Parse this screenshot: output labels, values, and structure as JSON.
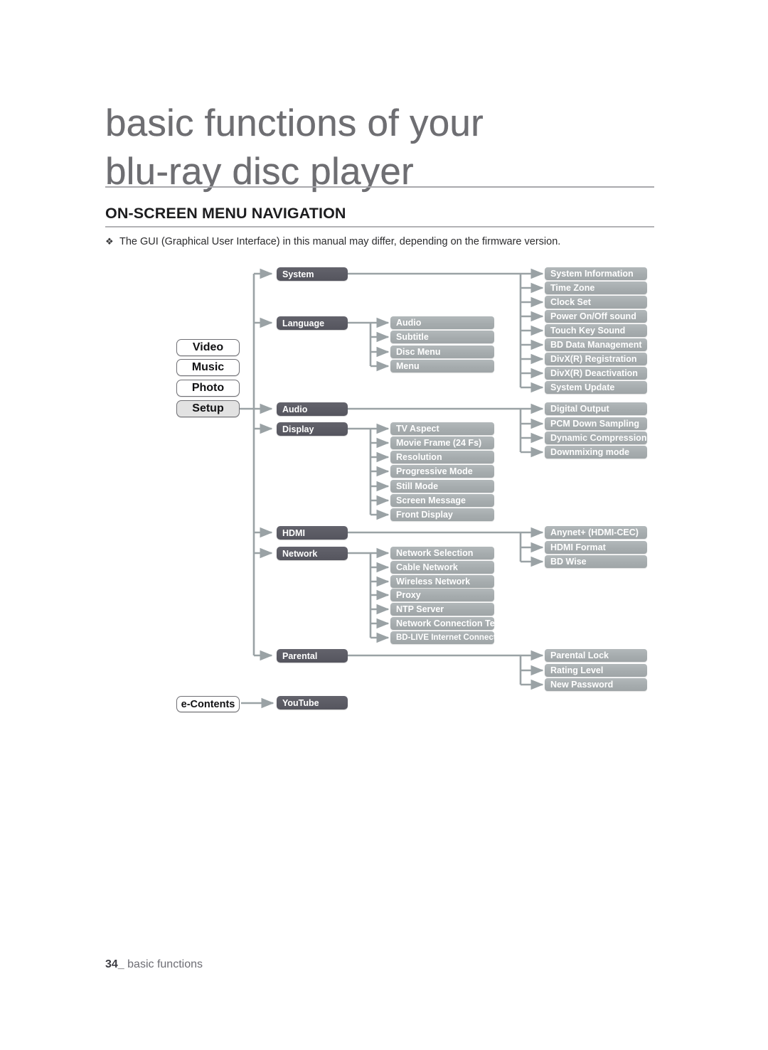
{
  "header": {
    "chapter_line1": "basic functions of your",
    "chapter_line2": "blu-ray disc player",
    "section_title": "ON-SCREEN MENU NAVIGATION",
    "note_bullet": "❖",
    "note_text": "The GUI (Graphical User Interface) in this manual may differ, depending on the firmware version."
  },
  "diagram": {
    "main_menu": [
      {
        "label": "Video",
        "selected": false
      },
      {
        "label": "Music",
        "selected": false
      },
      {
        "label": "Photo",
        "selected": false
      },
      {
        "label": "Setup",
        "selected": true
      }
    ],
    "e_contents": {
      "label": "e-Contents",
      "child": "YouTube"
    },
    "setup_categories": [
      {
        "label": "System"
      },
      {
        "label": "Language"
      },
      {
        "label": "Audio"
      },
      {
        "label": "Display"
      },
      {
        "label": "HDMI"
      },
      {
        "label": "Network"
      },
      {
        "label": "Parental"
      }
    ],
    "system_items": [
      "System Information",
      "Time Zone",
      "Clock Set",
      "Power On/Off sound",
      "Touch Key Sound",
      "BD Data Management",
      "DivX(R) Registration",
      "DivX(R) Deactivation",
      "System Update"
    ],
    "language_items": [
      "Audio",
      "Subtitle",
      "Disc Menu",
      "Menu"
    ],
    "audio_items": [
      "Digital Output",
      "PCM Down Sampling",
      "Dynamic Compression",
      "Downmixing mode"
    ],
    "display_items": [
      "TV Aspect",
      "Movie Frame (24 Fs)",
      "Resolution",
      "Progressive Mode",
      "Still Mode",
      "Screen Message",
      "Front Display"
    ],
    "hdmi_items": [
      "Anynet+ (HDMI-CEC)",
      "HDMI Format",
      "BD Wise"
    ],
    "network_items": [
      "Network Selection",
      "Cable Network",
      "Wireless Network",
      "Proxy",
      "NTP Server",
      "Network Connection Test",
      "BD-LIVE Internet Connection"
    ],
    "parental_items": [
      "Parental Lock",
      "Rating Level",
      "New Password"
    ]
  },
  "footer": {
    "page_number": "34",
    "separator": "_",
    "label": "basic functions"
  },
  "colors": {
    "dark_box": "#5b5b64",
    "light_box": "#a6acae",
    "connector": "#9aa2a5",
    "title_text": "#6e6e72",
    "selected_button": "#e2e2e2"
  }
}
